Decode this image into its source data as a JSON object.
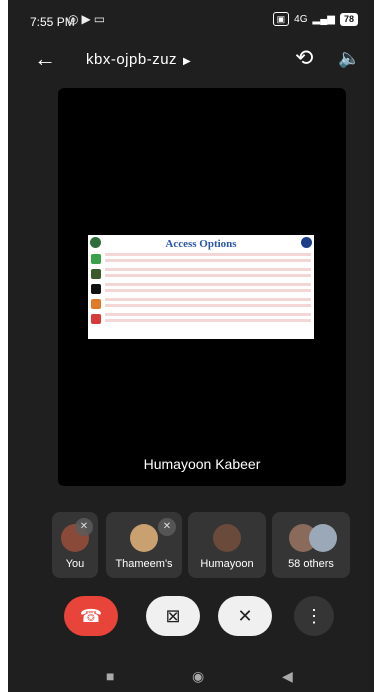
{
  "status_bar": {
    "time": "7:55 PM",
    "notification_icons": [
      "whatsapp-icon",
      "play-icon",
      "screen-icon"
    ],
    "network_type": "4G",
    "battery_level": "78"
  },
  "top_bar": {
    "meeting_code": "kbx-ojpb-zuz",
    "back_icon": "back-arrow-icon",
    "switch_camera_icon": "switch-camera-icon",
    "speaker_icon": "speaker-icon"
  },
  "stage": {
    "presenter_name": "Humayoon Kabeer",
    "slide": {
      "title": "Access Options"
    }
  },
  "participants": [
    {
      "label": "You",
      "muted": true
    },
    {
      "label": "Thameem's",
      "muted": true
    },
    {
      "label": "Humayoon",
      "muted": false
    },
    {
      "label": "58 others",
      "muted": false
    }
  ],
  "controls": {
    "end_call_icon": "end-call-icon",
    "camera_icon": "camera-off-icon",
    "mic_icon": "mic-off-icon",
    "more_icon": "more-options-icon"
  },
  "colors": {
    "end_call": "#e8443a",
    "background": "#1f1f1f",
    "tile": "#353535",
    "slide_title": "#2a58a8"
  }
}
